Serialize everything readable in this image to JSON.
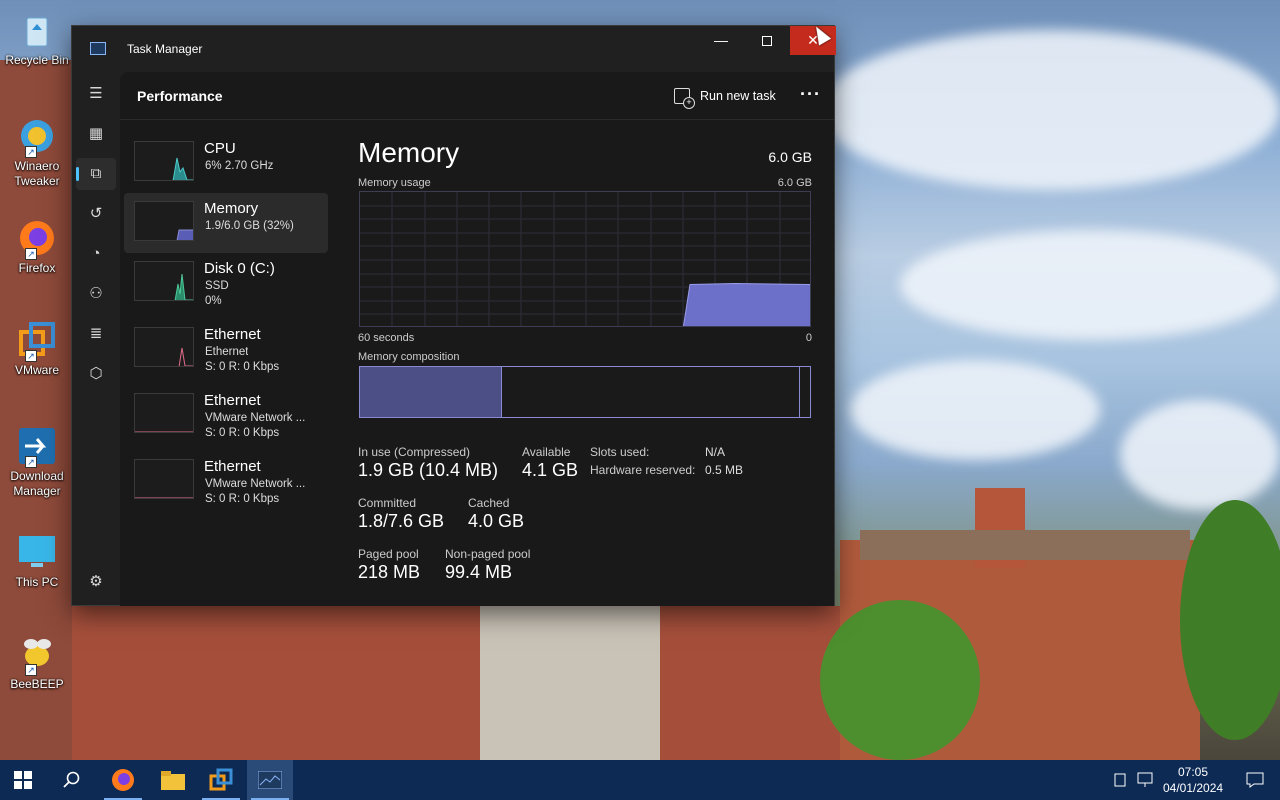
{
  "desktop": {
    "icons": [
      {
        "label": "Recycle Bin",
        "icon": "recycle-bin-icon"
      },
      {
        "label": "Winaero Tweaker",
        "icon": "winaero-tweaker-icon"
      },
      {
        "label": "Firefox",
        "icon": "firefox-icon"
      },
      {
        "label": "VMware",
        "icon": "vmware-icon"
      },
      {
        "label": "Download Manager",
        "icon": "download-manager-icon"
      },
      {
        "label": "This PC",
        "icon": "this-pc-icon"
      },
      {
        "label": "BeeBEEP",
        "icon": "beebeep-icon"
      }
    ]
  },
  "window": {
    "title": "Task Manager",
    "controls": {
      "minimize": "—",
      "maximize": "",
      "close": "✕"
    }
  },
  "nav": {
    "items": [
      {
        "icon": "hamburger-menu-icon"
      },
      {
        "icon": "processes-icon"
      },
      {
        "icon": "performance-icon",
        "active": true
      },
      {
        "icon": "app-history-icon"
      },
      {
        "icon": "startup-apps-icon"
      },
      {
        "icon": "users-icon"
      },
      {
        "icon": "details-icon"
      },
      {
        "icon": "services-icon"
      }
    ],
    "settings_icon": "settings-gear-icon"
  },
  "header": {
    "title": "Performance",
    "run_new_task": "Run new task",
    "more": "···"
  },
  "perf_list": [
    {
      "name": "CPU",
      "sub1": "6% 2.70 GHz",
      "sub2": ""
    },
    {
      "name": "Memory",
      "sub1": "1.9/6.0 GB (32%)",
      "sub2": "",
      "selected": true
    },
    {
      "name": "Disk 0 (C:)",
      "sub1": "SSD",
      "sub2": "0%"
    },
    {
      "name": "Ethernet",
      "sub1": "Ethernet",
      "sub2": "S: 0 R: 0 Kbps"
    },
    {
      "name": "Ethernet",
      "sub1": "VMware Network ...",
      "sub2": "S: 0 R: 0 Kbps"
    },
    {
      "name": "Ethernet",
      "sub1": "VMware Network ...",
      "sub2": "S: 0 R: 0 Kbps"
    }
  ],
  "memory": {
    "title": "Memory",
    "total": "6.0 GB",
    "usage_label": "Memory usage",
    "usage_max": "6.0 GB",
    "axis_left": "60 seconds",
    "axis_right": "0",
    "composition_label": "Memory composition",
    "in_use_fraction": 0.315,
    "modified_fraction": 0.975,
    "usage_fraction_recent": 0.32,
    "stats": {
      "in_use_label": "In use (Compressed)",
      "in_use_value": "1.9 GB (10.4 MB)",
      "available_label": "Available",
      "available_value": "4.1 GB",
      "slots_label": "Slots used:",
      "slots_value": "N/A",
      "hw_reserved_label": "Hardware reserved:",
      "hw_reserved_value": "0.5 MB",
      "committed_label": "Committed",
      "committed_value": "1.8/7.6 GB",
      "cached_label": "Cached",
      "cached_value": "4.0 GB",
      "paged_label": "Paged pool",
      "paged_value": "218 MB",
      "nonpaged_label": "Non-paged pool",
      "nonpaged_value": "99.4 MB"
    }
  },
  "taskbar": {
    "items": [
      {
        "icon": "start-windows-icon"
      },
      {
        "icon": "search-icon"
      },
      {
        "icon": "firefox-icon"
      },
      {
        "icon": "file-explorer-icon"
      },
      {
        "icon": "vmware-icon"
      },
      {
        "icon": "task-manager-icon"
      }
    ],
    "time": "07:05",
    "date": "04/01/2024"
  },
  "colors": {
    "accent": "#4cc2ff",
    "memory_fill": "#6d70c8",
    "close_hover": "#c42b1c"
  }
}
